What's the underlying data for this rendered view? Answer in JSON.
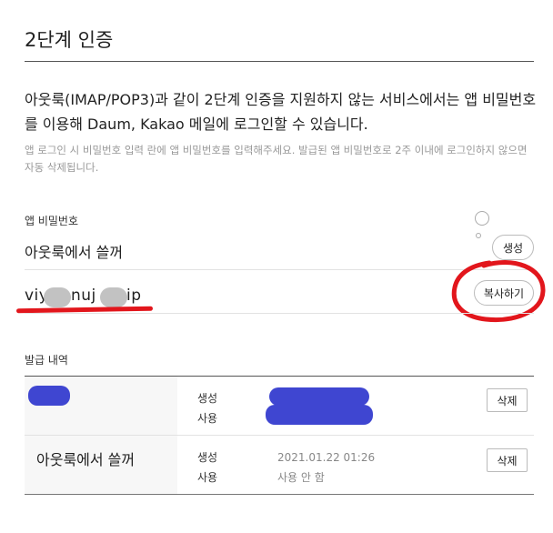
{
  "page": {
    "title": "2단계 인증",
    "description": "아웃룩(IMAP/POP3)과 같이 2단계 인증을 지원하지 않는 서비스에서는 앱 비밀번호를 이용해 Daum, Kakao 메일에 로그인할 수 있습니다.",
    "note": "앱 로그인 시 비밀번호 입력 란에 앱 비밀번호를 입력해주세요. 발급된 앱 비밀번호로 2주 이내에 로그인하지 않으면 자동 삭제됩니다."
  },
  "app_password": {
    "label": "앱 비밀번호",
    "name": "아웃룩에서 쓸꺼",
    "generate_label": "생성",
    "value_parts": [
      "viy",
      "nuj",
      "ip"
    ],
    "copy_label": "복사하기"
  },
  "history": {
    "label": "발급 내역",
    "rows": [
      {
        "name": "",
        "created_label": "생성",
        "used_label": "사용",
        "created_value": "",
        "used_value": "",
        "delete_label": "삭제"
      },
      {
        "name": "아웃룩에서 쓸꺼",
        "created_label": "생성",
        "used_label": "사용",
        "created_value": "2021.01.22 01:26",
        "used_value": "사용 안 함",
        "delete_label": "삭제"
      }
    ]
  },
  "colors": {
    "redaction": "#3f46d1",
    "annotation": "#e2161c",
    "row_highlight": "#f7f7f7"
  }
}
